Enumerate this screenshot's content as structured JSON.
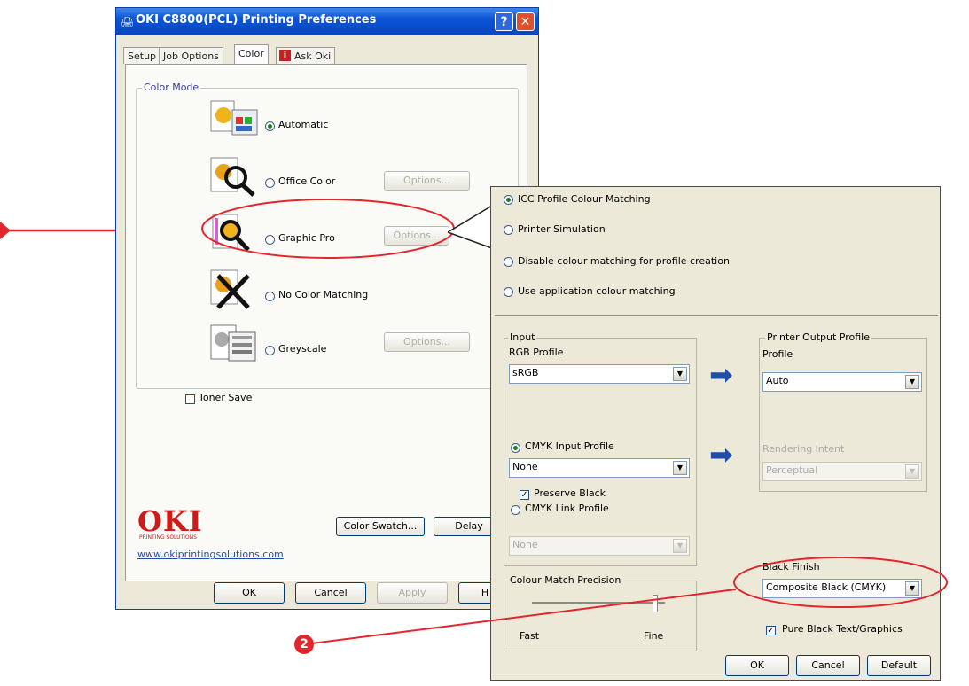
{
  "window": {
    "title": "OKI C8800(PCL) Printing Preferences",
    "help_label": "?",
    "close_label": "✕"
  },
  "tabs": [
    {
      "label": "Setup"
    },
    {
      "label": "Job Options"
    },
    {
      "label": "Color"
    },
    {
      "label": "Ask Oki"
    }
  ],
  "color_mode": {
    "legend": "Color Mode",
    "options": [
      {
        "label": "Automatic",
        "selected": true,
        "has_options": false
      },
      {
        "label": "Office Color",
        "selected": false,
        "has_options": true
      },
      {
        "label": "Graphic Pro",
        "selected": false,
        "has_options": true
      },
      {
        "label": "No Color Matching",
        "selected": false,
        "has_options": false
      },
      {
        "label": "Greyscale",
        "selected": false,
        "has_options": true
      }
    ],
    "options_button": "Options..."
  },
  "toner_save": {
    "label": "Toner Save",
    "checked": false
  },
  "branding": {
    "logo": "OKI",
    "tagline": "PRINTING SOLUTIONS",
    "url": "www.okiprintingsolutions.com"
  },
  "buttons": {
    "color_swatch": "Color Swatch...",
    "delay": "Delay",
    "ok": "OK",
    "cancel": "Cancel",
    "apply": "Apply",
    "help": "H"
  },
  "popup": {
    "modes": [
      {
        "label": "ICC Profile Colour Matching",
        "selected": true
      },
      {
        "label": "Printer Simulation",
        "selected": false
      },
      {
        "label": "Disable colour matching for profile creation",
        "selected": false
      },
      {
        "label": "Use application colour matching",
        "selected": false
      }
    ],
    "input": {
      "legend": "Input",
      "rgb_label": "RGB Profile",
      "rgb_value": "sRGB",
      "cmyk_input_label": "CMYK Input Profile",
      "cmyk_input_selected": true,
      "cmyk_input_value": "None",
      "preserve_black_label": "Preserve Black",
      "preserve_black_checked": true,
      "cmyk_link_label": "CMYK Link Profile",
      "cmyk_link_value": "None"
    },
    "printer_output": {
      "legend": "Printer Output Profile",
      "profile_label": "Profile",
      "profile_value": "Auto",
      "rendering_label": "Rendering Intent",
      "rendering_value": "Perceptual"
    },
    "precision": {
      "legend": "Colour Match Precision",
      "fast": "Fast",
      "fine": "Fine"
    },
    "black_finish": {
      "label": "Black Finish",
      "value": "Composite Black (CMYK)"
    },
    "pure_black": {
      "label": "Pure Black Text/Graphics",
      "checked": true
    },
    "ok": "OK",
    "cancel": "Cancel",
    "default": "Default"
  },
  "callout_number": "2",
  "colors": {
    "callout_red": "#e3262b",
    "title_blue": "#0b55d6",
    "oki_red": "#cf1a1a",
    "arrow_blue": "#1f4fa8"
  }
}
